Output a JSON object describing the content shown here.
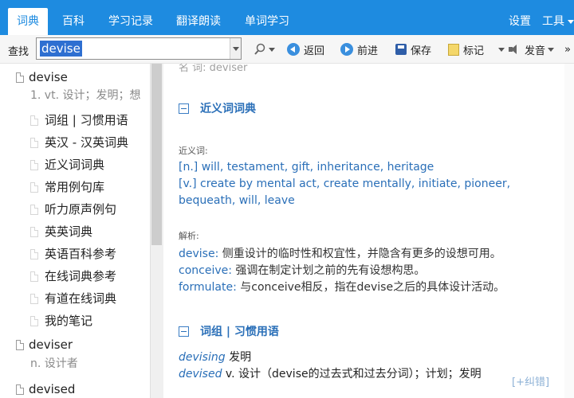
{
  "tabs": [
    {
      "label": "词典"
    },
    {
      "label": "百科"
    },
    {
      "label": "学习记录"
    },
    {
      "label": "翻译朗读"
    },
    {
      "label": "单词学习"
    }
  ],
  "top_right": {
    "settings": "设置",
    "tools": "工具",
    "more": "»"
  },
  "toolbar": {
    "find_label": "查找",
    "search_value": "devise",
    "back": "返回",
    "forward": "前进",
    "save": "保存",
    "mark": "标记",
    "speak": "发音",
    "more": "»"
  },
  "left": {
    "entry": {
      "word": "devise",
      "gloss": "1. vt. 设计；发明；想"
    },
    "sub_items": [
      "词组 | 习惯用语",
      "英汉 - 汉英词典",
      "近义词词典",
      "常用例句库",
      "听力原声例句",
      "英英词典",
      "英语百科参考",
      "在线词典参考",
      "有道在线词典",
      "我的笔记"
    ],
    "entry2": {
      "word": "deviser",
      "gloss": "n. 设计者"
    },
    "entry3": {
      "word": "devised"
    }
  },
  "right": {
    "cutoff": "名 词: deviser",
    "syn_section": {
      "title": "近义词词典",
      "syn_label": "近义词:",
      "noun_tag": "[n.]",
      "noun_line": " will, testament, gift, inheritance, heritage",
      "verb_tag": "[v.]",
      "verb_line": " create by mental act, create mentally, initiate, pioneer,",
      "verb_line2": "bequeath, will, leave",
      "analysis_label": "解析:",
      "analysis": [
        {
          "word": "devise:",
          "text": " 侧重设计的临时性和权宜性，并隐含有更多的设想可用。"
        },
        {
          "word": "conceive:",
          "text": " 强调在制定计划之前的先有设想构思。"
        },
        {
          "word": "formulate:",
          "text": " 与conceive相反，指在devise之后的具体设计活动。"
        }
      ]
    },
    "phrase_section": {
      "title": "词组 | 习惯用语",
      "examples": [
        {
          "word": "devising",
          "text": "  发明"
        },
        {
          "word": "devised",
          "text": "  v. 设计（devise的过去式和过去分词）；计划；发明"
        }
      ]
    },
    "fix_link": "[+纠错]"
  },
  "colors": {
    "accent": "#1e8be0",
    "link": "#2a6fb8"
  }
}
